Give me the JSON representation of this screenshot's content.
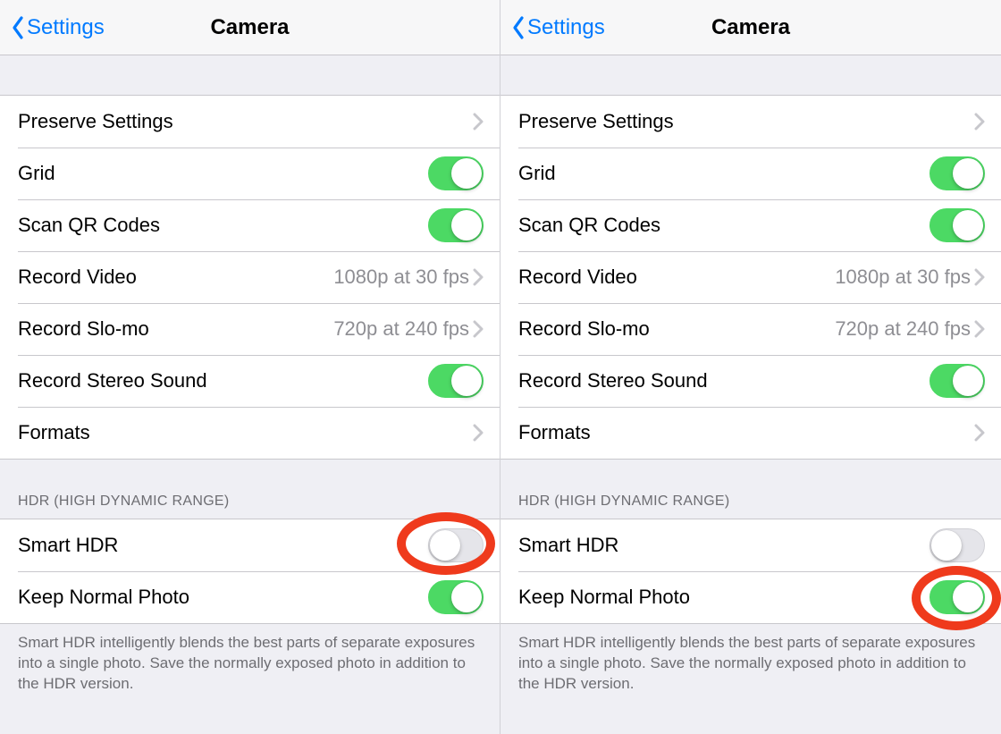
{
  "panes": [
    {
      "back_label": "Settings",
      "title": "Camera",
      "rows": {
        "preserve": {
          "label": "Preserve Settings"
        },
        "grid": {
          "label": "Grid",
          "on": true
        },
        "qr": {
          "label": "Scan QR Codes",
          "on": true
        },
        "video": {
          "label": "Record Video",
          "value": "1080p at 30 fps"
        },
        "slomo": {
          "label": "Record Slo-mo",
          "value": "720p at 240 fps"
        },
        "stereo": {
          "label": "Record Stereo Sound",
          "on": true
        },
        "formats": {
          "label": "Formats"
        }
      },
      "hdr_header": "HDR (HIGH DYNAMIC RANGE)",
      "hdr": {
        "smart": {
          "label": "Smart HDR",
          "on": false
        },
        "keep": {
          "label": "Keep Normal Photo",
          "on": true
        }
      },
      "footer": "Smart HDR intelligently blends the best parts of separate exposures into a single photo. Save the normally exposed photo in addition to the HDR version.",
      "circle_target": "smart"
    },
    {
      "back_label": "Settings",
      "title": "Camera",
      "rows": {
        "preserve": {
          "label": "Preserve Settings"
        },
        "grid": {
          "label": "Grid",
          "on": true
        },
        "qr": {
          "label": "Scan QR Codes",
          "on": true
        },
        "video": {
          "label": "Record Video",
          "value": "1080p at 30 fps"
        },
        "slomo": {
          "label": "Record Slo-mo",
          "value": "720p at 240 fps"
        },
        "stereo": {
          "label": "Record Stereo Sound",
          "on": true
        },
        "formats": {
          "label": "Formats"
        }
      },
      "hdr_header": "HDR (HIGH DYNAMIC RANGE)",
      "hdr": {
        "smart": {
          "label": "Smart HDR",
          "on": false
        },
        "keep": {
          "label": "Keep Normal Photo",
          "on": true
        }
      },
      "footer": "Smart HDR intelligently blends the best parts of separate exposures into a single photo. Save the normally exposed photo in addition to the HDR version.",
      "circle_target": "keep"
    }
  ]
}
